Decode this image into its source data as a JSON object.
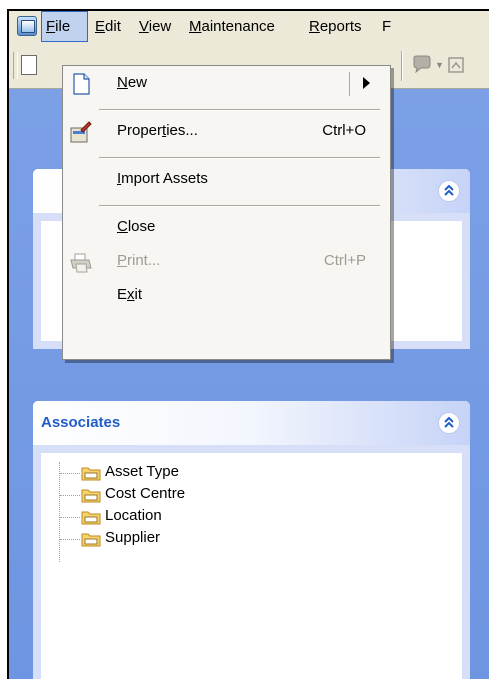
{
  "menubar": {
    "items": [
      {
        "label": "File",
        "mnemonic": "F"
      },
      {
        "label": "Edit",
        "mnemonic": "E"
      },
      {
        "label": "View",
        "mnemonic": "V"
      },
      {
        "label": "Maintenance",
        "mnemonic": "M"
      },
      {
        "label": "Reports",
        "mnemonic": "R"
      },
      {
        "label": "F",
        "mnemonic": ""
      }
    ],
    "active": "File"
  },
  "file_menu": {
    "items": [
      {
        "label": "New",
        "shortcut": "",
        "has_submenu": true,
        "icon": "new-document-icon"
      },
      {
        "label": "Properties...",
        "shortcut": "Ctrl+O",
        "icon": "properties-icon"
      },
      {
        "label": "Import Assets",
        "shortcut": ""
      },
      {
        "label": "Close",
        "shortcut": ""
      },
      {
        "label": "Print...",
        "shortcut": "Ctrl+P",
        "disabled": true,
        "icon": "printer-icon"
      },
      {
        "label": "Exit",
        "shortcut": ""
      }
    ]
  },
  "associates_panel": {
    "title": "Associates",
    "items": [
      "Asset Type",
      "Cost Centre",
      "Location",
      "Supplier"
    ]
  },
  "colors": {
    "workarea": "#7ba0e6",
    "panel_title": "#215dc6",
    "menu_highlight": "#c1d2ee",
    "menu_bg": "#ece9d8"
  }
}
